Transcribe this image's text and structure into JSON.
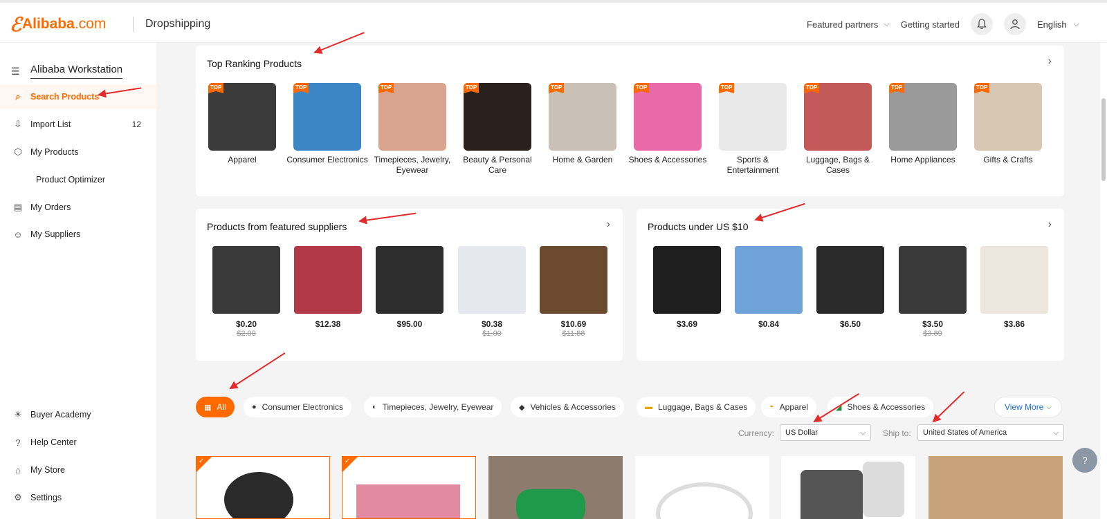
{
  "header": {
    "logo_text": "Alibaba",
    "logo_suffix": ".com",
    "app_title": "Dropshipping",
    "featured_partners": "Featured partners",
    "getting_started": "Getting started",
    "language": "English"
  },
  "sidebar": {
    "workstation_title": "Alibaba Workstation",
    "items": [
      {
        "label": "Search Products",
        "icon": "search-icon",
        "active": true
      },
      {
        "label": "Import List",
        "icon": "import-icon",
        "badge": "12"
      },
      {
        "label": "My Products",
        "icon": "box-icon"
      },
      {
        "label": "Product Optimizer",
        "icon": ""
      },
      {
        "label": "My Orders",
        "icon": "orders-icon"
      },
      {
        "label": "My Suppliers",
        "icon": "user-icon"
      }
    ],
    "footer_items": [
      {
        "label": "Buyer Academy",
        "icon": "lightbulb-icon"
      },
      {
        "label": "Help Center",
        "icon": "help-icon"
      },
      {
        "label": "My Store",
        "icon": "store-icon"
      },
      {
        "label": "Settings",
        "icon": "gear-icon"
      }
    ]
  },
  "top_ranking": {
    "title": "Top Ranking Products",
    "tag": "TOP",
    "categories": [
      {
        "label": "Apparel",
        "color": "#3b3b3b"
      },
      {
        "label": "Consumer Electronics",
        "color": "#3d86c6"
      },
      {
        "label": "Timepieces, Jewelry, Eyewear",
        "color": "#d9a48e"
      },
      {
        "label": "Beauty & Personal Care",
        "color": "#2b211c"
      },
      {
        "label": "Home & Garden",
        "color": "#c9c1b5"
      },
      {
        "label": "Shoes & Accessories",
        "color": "#e86aa8"
      },
      {
        "label": "Sports & Entertainment",
        "color": "#e9e9e9"
      },
      {
        "label": "Luggage, Bags & Cases",
        "color": "#c25a5a"
      },
      {
        "label": "Home Appliances",
        "color": "#9a9a9a"
      },
      {
        "label": "Gifts & Crafts",
        "color": "#d7c7b3"
      }
    ]
  },
  "featured_suppliers": {
    "title": "Products from featured suppliers",
    "products": [
      {
        "price": "$0.20",
        "old_price": "$2.00",
        "color": "#3a3a3a"
      },
      {
        "price": "$12.38",
        "old_price": "",
        "color": "#b23a48"
      },
      {
        "price": "$95.00",
        "old_price": "",
        "color": "#2d2d2d"
      },
      {
        "price": "$0.38",
        "old_price": "$1.00",
        "color": "#e7e7ef"
      },
      {
        "price": "$10.69",
        "old_price": "$11.88",
        "color": "#6b4a2e"
      }
    ]
  },
  "under_10": {
    "title": "Products under US $10",
    "products": [
      {
        "price": "$3.69",
        "old_price": "",
        "color": "#1e1e1e"
      },
      {
        "price": "$0.84",
        "old_price": "",
        "color": "#6fa3d8"
      },
      {
        "price": "$6.50",
        "old_price": "",
        "color": "#2a2a2a"
      },
      {
        "price": "$3.50",
        "old_price": "$3.89",
        "color": "#3a3a3a"
      },
      {
        "price": "$3.86",
        "old_price": "",
        "color": "#ece6df"
      }
    ]
  },
  "filters": {
    "chips": [
      {
        "label": "All",
        "icon": "grid-icon",
        "active": true
      },
      {
        "label": "Consumer Electronics",
        "icon": "electronics-icon"
      },
      {
        "label": "Timepieces, Jewelry, Eyewear",
        "icon": "watch-icon"
      },
      {
        "label": "Vehicles & Accessories",
        "icon": "vehicle-icon"
      },
      {
        "label": "Luggage, Bags & Cases",
        "icon": "luggage-icon"
      },
      {
        "label": "Apparel",
        "icon": "apparel-icon"
      },
      {
        "label": "Shoes & Accessories",
        "icon": "shoe-icon"
      }
    ],
    "view_more": "View More",
    "currency_label": "Currency:",
    "currency_value": "US Dollar",
    "ship_label": "Ship to:",
    "ship_value": "United States of America"
  },
  "grid_products": [
    {
      "selected": true,
      "color": "#2a2a2a"
    },
    {
      "selected": true,
      "color": "#e48aa0"
    },
    {
      "selected": false,
      "color": "#1f9a4a"
    },
    {
      "selected": false,
      "color": "#e8e8e8"
    },
    {
      "selected": false,
      "color": "#555555"
    },
    {
      "selected": false,
      "color": "#c7a27a"
    }
  ],
  "colors": {
    "accent": "#ff6a00",
    "annotation_arrow": "#e32b2b",
    "link": "#1a6fd6"
  }
}
